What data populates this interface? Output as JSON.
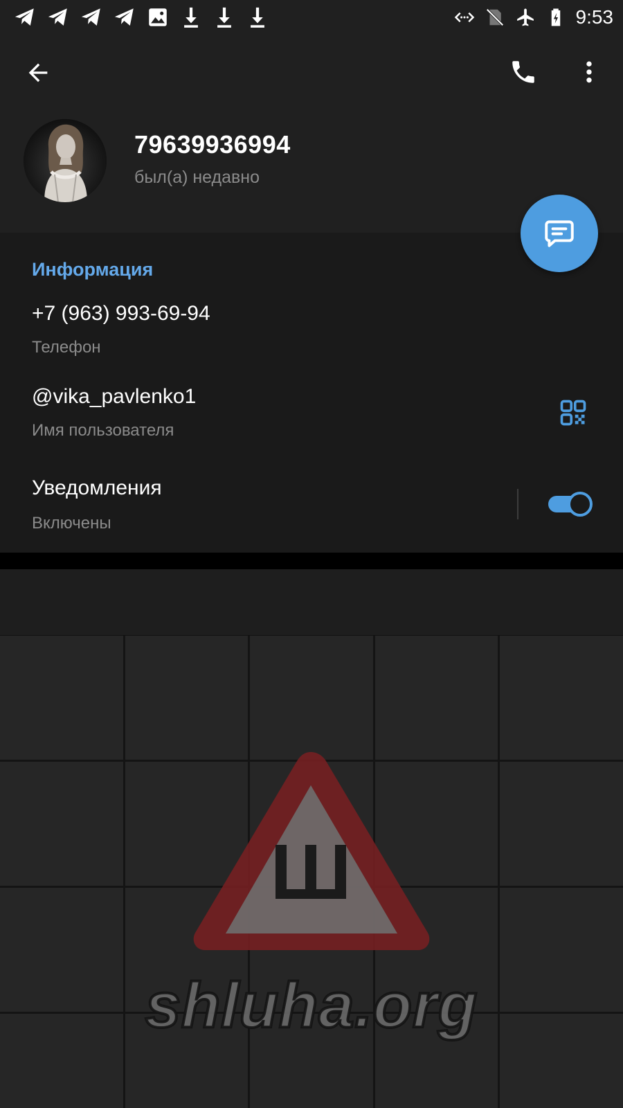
{
  "status_bar": {
    "left_icons": [
      "telegram-icon",
      "telegram-icon",
      "telegram-icon",
      "telegram-icon",
      "image-icon",
      "download-icon",
      "download-icon",
      "download-icon"
    ],
    "right_icons": [
      "data-saver-icon",
      "no-sim-icon",
      "airplane-icon",
      "battery-charging-icon"
    ],
    "time": "9:53"
  },
  "toolbar": {
    "back_icon": "arrow-back-icon",
    "call_icon": "phone-icon",
    "menu_icon": "more-vertical-icon"
  },
  "profile": {
    "name": "79639936994",
    "status": "был(а) недавно"
  },
  "fab_icon": "message-icon",
  "info": {
    "title": "Информация",
    "phone": {
      "value": "+7 (963) 993-69-94",
      "label": "Телефон"
    },
    "username": {
      "value": "@vika_pavlenko1",
      "label": "Имя пользователя",
      "icon": "qr-code-icon"
    },
    "notifications": {
      "value": "Уведомления",
      "label": "Включены",
      "enabled": true
    }
  },
  "watermark": {
    "text": "shluha.org",
    "sign_letter": "Ш"
  },
  "colors": {
    "accent": "#4e9de0",
    "section_title": "#64a9ea",
    "background": "#202020",
    "section_background": "#1a1a1a",
    "secondary_text": "#8b8b8b",
    "watermark_red": "#8b1f22"
  }
}
